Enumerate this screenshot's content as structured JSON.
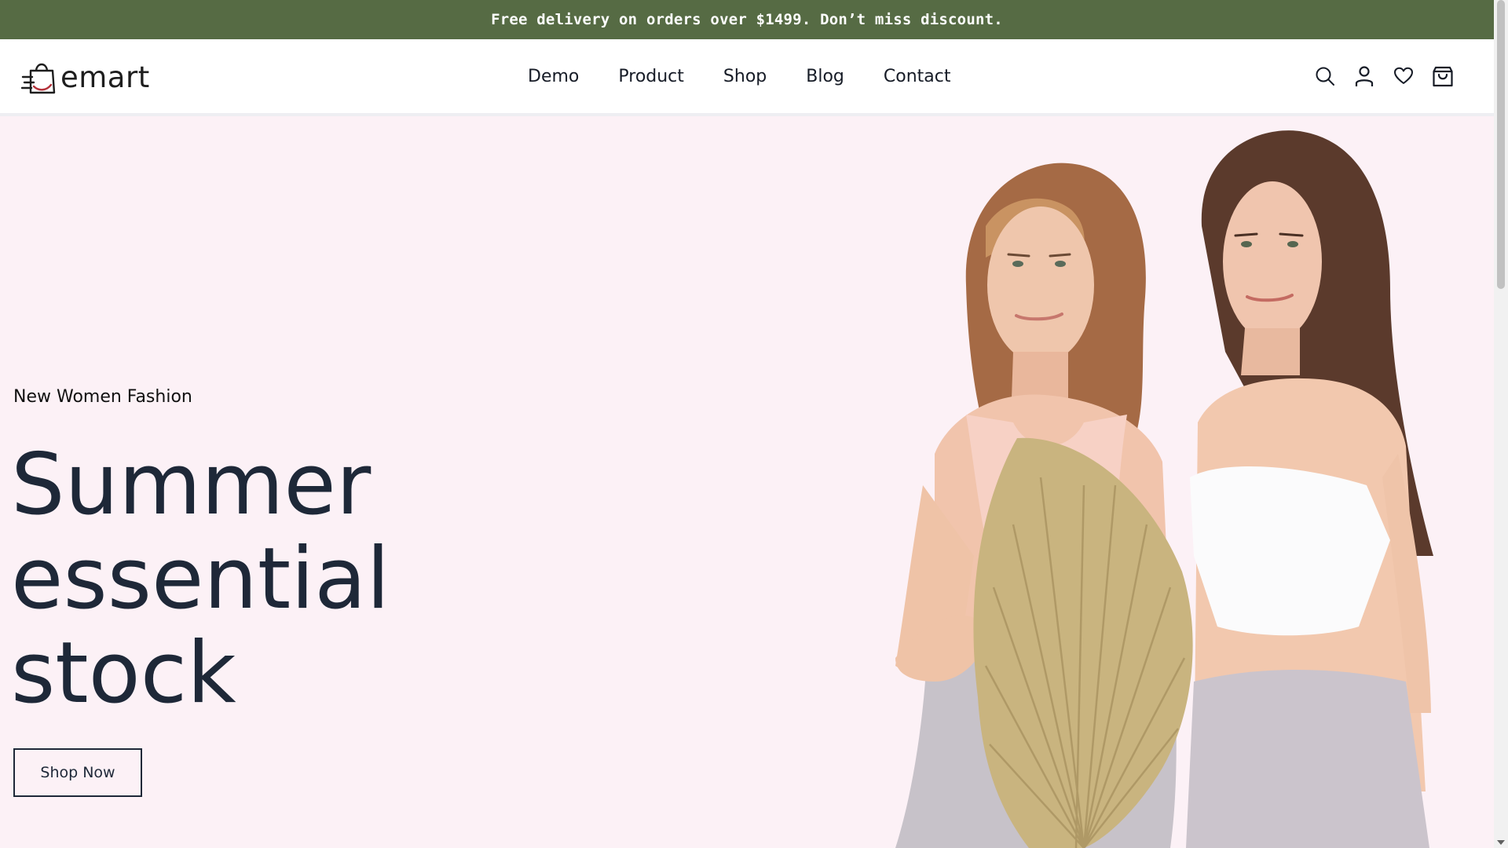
{
  "promo": {
    "text": "Free delivery on orders over $1499. Don’t miss discount."
  },
  "header": {
    "logo_text": "emart",
    "nav": [
      {
        "label": "Demo"
      },
      {
        "label": "Product"
      },
      {
        "label": "Shop"
      },
      {
        "label": "Blog"
      },
      {
        "label": "Contact"
      }
    ],
    "icons": [
      "search-icon",
      "user-icon",
      "heart-icon",
      "cart-icon"
    ]
  },
  "hero": {
    "subtitle": "New Women Fashion",
    "title_lines": [
      "Summer",
      "essential",
      "stock"
    ],
    "button_label": "Shop Now",
    "image_subject": "two-women-models-with-dried-palm-leaf"
  },
  "colors": {
    "promo_bg": "#566b44",
    "hero_bg": "#fcf1f6",
    "heading": "#1e2838",
    "logo_accent": "#b5323a"
  }
}
